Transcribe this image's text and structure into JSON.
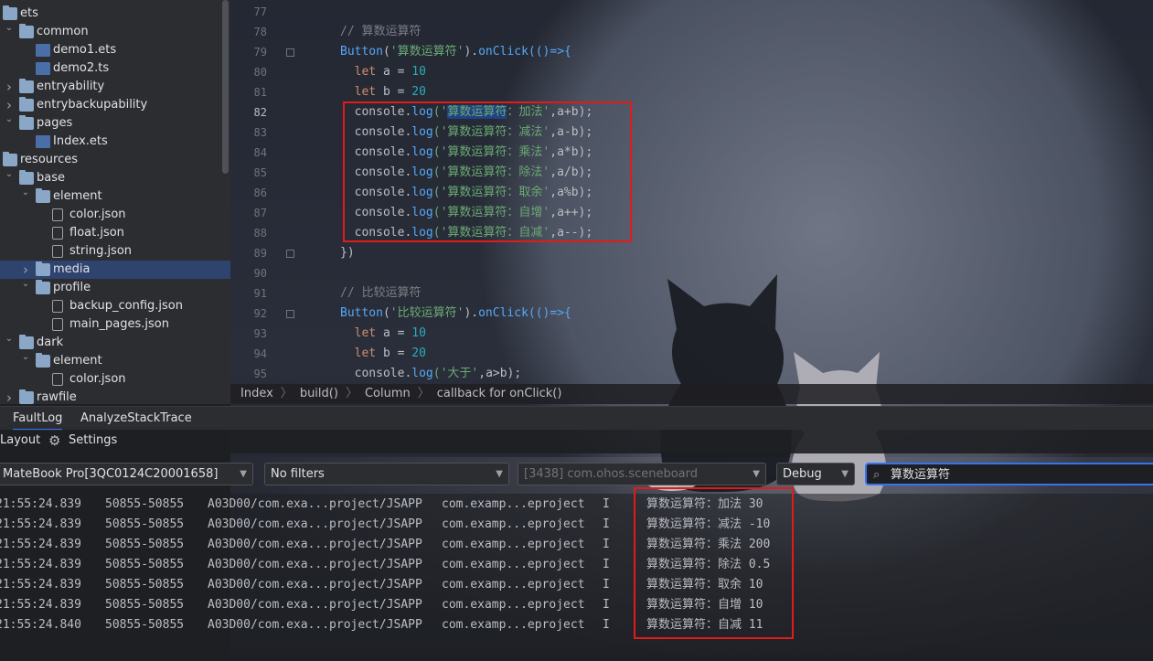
{
  "project_tree": [
    {
      "label": "ets",
      "depth": 0,
      "type": "folder",
      "expanded": true
    },
    {
      "label": "common",
      "depth": 1,
      "type": "folder",
      "expanded": true
    },
    {
      "label": "demo1.ets",
      "depth": 2,
      "type": "file-ets"
    },
    {
      "label": "demo2.ts",
      "depth": 2,
      "type": "file-ets"
    },
    {
      "label": "entryability",
      "depth": 1,
      "type": "folder",
      "expanded": false
    },
    {
      "label": "entrybackupability",
      "depth": 1,
      "type": "folder",
      "expanded": false
    },
    {
      "label": "pages",
      "depth": 1,
      "type": "folder",
      "expanded": true
    },
    {
      "label": "Index.ets",
      "depth": 2,
      "type": "file-ets"
    },
    {
      "label": "resources",
      "depth": 0,
      "type": "folder",
      "expanded": true
    },
    {
      "label": "base",
      "depth": 1,
      "type": "folder",
      "expanded": true
    },
    {
      "label": "element",
      "depth": 2,
      "type": "folder",
      "expanded": true
    },
    {
      "label": "color.json",
      "depth": 3,
      "type": "file-json"
    },
    {
      "label": "float.json",
      "depth": 3,
      "type": "file-json"
    },
    {
      "label": "string.json",
      "depth": 3,
      "type": "file-json"
    },
    {
      "label": "media",
      "depth": 2,
      "type": "folder",
      "expanded": false,
      "selected": true
    },
    {
      "label": "profile",
      "depth": 2,
      "type": "folder",
      "expanded": true
    },
    {
      "label": "backup_config.json",
      "depth": 3,
      "type": "file-json"
    },
    {
      "label": "main_pages.json",
      "depth": 3,
      "type": "file-json"
    },
    {
      "label": "dark",
      "depth": 1,
      "type": "folder",
      "expanded": true
    },
    {
      "label": "element",
      "depth": 2,
      "type": "folder",
      "expanded": true
    },
    {
      "label": "color.json",
      "depth": 3,
      "type": "file-json"
    },
    {
      "label": "rawfile",
      "depth": 1,
      "type": "folder",
      "expanded": false
    }
  ],
  "editor": {
    "line_numbers": [
      "77",
      "78",
      "79",
      "80",
      "81",
      "82",
      "83",
      "84",
      "85",
      "86",
      "87",
      "88",
      "89",
      "90",
      "91",
      "92",
      "93",
      "94",
      "95"
    ],
    "current_line": "82",
    "lines": [
      [],
      [
        {
          "t": "// 算数运算符",
          "c": "cm"
        }
      ],
      [
        {
          "t": "Button",
          "c": "fn"
        },
        {
          "t": "(",
          "c": ""
        },
        {
          "t": "'算数运算符'",
          "c": "str"
        },
        {
          "t": ").",
          "c": ""
        },
        {
          "t": "onClick",
          "c": "fn"
        },
        {
          "t": "(()=>{",
          "c": "fn"
        }
      ],
      [
        {
          "t": "  let ",
          "c": "kw"
        },
        {
          "t": "a = ",
          "c": ""
        },
        {
          "t": "10",
          "c": "num"
        }
      ],
      [
        {
          "t": "  let ",
          "c": "kw"
        },
        {
          "t": "b = ",
          "c": ""
        },
        {
          "t": "20",
          "c": "num"
        }
      ],
      [
        {
          "t": "  console.",
          "c": ""
        },
        {
          "t": "log",
          "c": "fn"
        },
        {
          "t": "('",
          "c": "str"
        },
        {
          "t": "算数运算符",
          "c": "str hl"
        },
        {
          "t": "：加法'",
          "c": "str"
        },
        {
          "t": ",a+b);",
          "c": ""
        }
      ],
      [
        {
          "t": "  console.",
          "c": ""
        },
        {
          "t": "log",
          "c": "fn"
        },
        {
          "t": "('算数运算符：减法'",
          "c": "str"
        },
        {
          "t": ",a-b);",
          "c": ""
        }
      ],
      [
        {
          "t": "  console.",
          "c": ""
        },
        {
          "t": "log",
          "c": "fn"
        },
        {
          "t": "('算数运算符：乘法'",
          "c": "str"
        },
        {
          "t": ",a*b);",
          "c": ""
        }
      ],
      [
        {
          "t": "  console.",
          "c": ""
        },
        {
          "t": "log",
          "c": "fn"
        },
        {
          "t": "('算数运算符：除法'",
          "c": "str"
        },
        {
          "t": ",a/b);",
          "c": ""
        }
      ],
      [
        {
          "t": "  console.",
          "c": ""
        },
        {
          "t": "log",
          "c": "fn"
        },
        {
          "t": "('算数运算符：取余'",
          "c": "str"
        },
        {
          "t": ",a%b);",
          "c": ""
        }
      ],
      [
        {
          "t": "  console.",
          "c": ""
        },
        {
          "t": "log",
          "c": "fn"
        },
        {
          "t": "('算数运算符：自增'",
          "c": "str"
        },
        {
          "t": ",a++);",
          "c": ""
        }
      ],
      [
        {
          "t": "  console.",
          "c": ""
        },
        {
          "t": "log",
          "c": "fn"
        },
        {
          "t": "('算数运算符：自减'",
          "c": "str"
        },
        {
          "t": ",a--);",
          "c": ""
        }
      ],
      [
        {
          "t": "})",
          "c": ""
        }
      ],
      [],
      [
        {
          "t": "// 比较运算符",
          "c": "cm"
        }
      ],
      [
        {
          "t": "Button",
          "c": "fn"
        },
        {
          "t": "(",
          "c": ""
        },
        {
          "t": "'比较运算符'",
          "c": "str"
        },
        {
          "t": ").",
          "c": ""
        },
        {
          "t": "onClick",
          "c": "fn"
        },
        {
          "t": "(()=>{",
          "c": "fn"
        }
      ],
      [
        {
          "t": "  let ",
          "c": "kw"
        },
        {
          "t": "a = ",
          "c": ""
        },
        {
          "t": "10",
          "c": "num"
        }
      ],
      [
        {
          "t": "  let ",
          "c": "kw"
        },
        {
          "t": "b = ",
          "c": ""
        },
        {
          "t": "20",
          "c": "num"
        }
      ],
      [
        {
          "t": "  console.",
          "c": ""
        },
        {
          "t": "log",
          "c": "fn"
        },
        {
          "t": "('大于'",
          "c": "str"
        },
        {
          "t": ",a>b);",
          "c": ""
        }
      ]
    ]
  },
  "breadcrumb": [
    "Index",
    "build()",
    "Column",
    "callback for onClick()"
  ],
  "bottom_tabs": [
    "FaultLog",
    "AnalyzeStackTrace"
  ],
  "toolbar": {
    "layout_label": "Layout",
    "settings_label": "Settings"
  },
  "filters": {
    "device": "MateBook Pro[3QC0124C20001658]",
    "filter": "No filters",
    "process": "[3438] com.ohos.sceneboard",
    "level": "Debug",
    "search_value": "算数运算符"
  },
  "log_rows": [
    {
      "time": "21:55:24.839",
      "pid": "50855-50855",
      "tag": "A03D00/com.exa...project/JSAPP",
      "pkg": "com.examp...eproject",
      "level": "I",
      "msg": "算数运算符：加法 30"
    },
    {
      "time": "21:55:24.839",
      "pid": "50855-50855",
      "tag": "A03D00/com.exa...project/JSAPP",
      "pkg": "com.examp...eproject",
      "level": "I",
      "msg": "算数运算符：减法 -10"
    },
    {
      "time": "21:55:24.839",
      "pid": "50855-50855",
      "tag": "A03D00/com.exa...project/JSAPP",
      "pkg": "com.examp...eproject",
      "level": "I",
      "msg": "算数运算符：乘法 200"
    },
    {
      "time": "21:55:24.839",
      "pid": "50855-50855",
      "tag": "A03D00/com.exa...project/JSAPP",
      "pkg": "com.examp...eproject",
      "level": "I",
      "msg": "算数运算符：除法 0.5"
    },
    {
      "time": "21:55:24.839",
      "pid": "50855-50855",
      "tag": "A03D00/com.exa...project/JSAPP",
      "pkg": "com.examp...eproject",
      "level": "I",
      "msg": "算数运算符：取余 10"
    },
    {
      "time": "21:55:24.839",
      "pid": "50855-50855",
      "tag": "A03D00/com.exa...project/JSAPP",
      "pkg": "com.examp...eproject",
      "level": "I",
      "msg": "算数运算符：自增 10"
    },
    {
      "time": "21:55:24.840",
      "pid": "50855-50855",
      "tag": "A03D00/com.exa...project/JSAPP",
      "pkg": "com.examp...eproject",
      "level": "I",
      "msg": "算数运算符：自减 11"
    }
  ],
  "colors": {
    "annotation_red": "#e01b1b",
    "selection": "#2e436e",
    "accent": "#3574f0"
  }
}
